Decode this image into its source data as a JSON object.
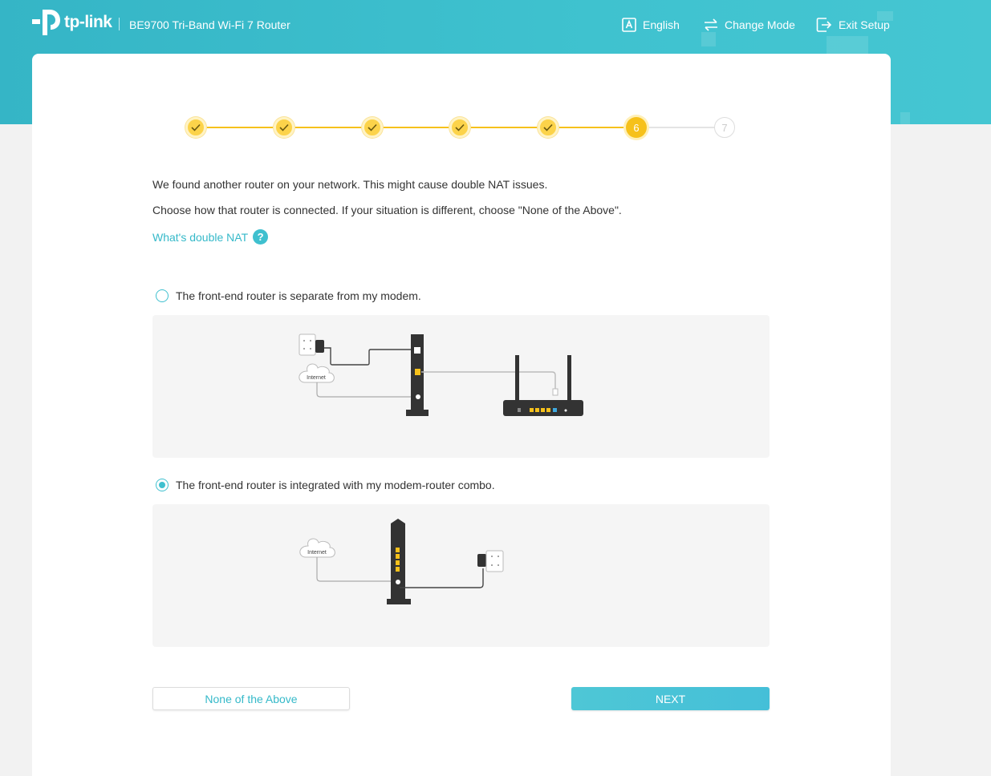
{
  "header": {
    "logo_text": "tp-link",
    "product_name": "BE9700 Tri-Band Wi-Fi 7 Router",
    "language_icon": "language-a-icon",
    "language_label": "English",
    "change_mode_icon": "switch-arrows-icon",
    "change_mode_label": "Change Mode",
    "exit_icon": "exit-arrow-icon",
    "exit_label": "Exit Setup"
  },
  "stepper": {
    "steps": [
      {
        "state": "done"
      },
      {
        "state": "done"
      },
      {
        "state": "done"
      },
      {
        "state": "done"
      },
      {
        "state": "done"
      },
      {
        "state": "active",
        "label": "6"
      },
      {
        "state": "todo",
        "label": "7"
      }
    ],
    "accent_color": "#f6c11b"
  },
  "content": {
    "line1": "We found another router on your network. This might cause double NAT issues.",
    "line2": "Choose how that router is connected. If your situation is different, choose \"None of the Above\".",
    "help_link": "What's double NAT",
    "help_icon": "question-mark-icon"
  },
  "options": [
    {
      "label": "The front-end router is separate from my modem.",
      "selected": false,
      "diagram_cloud_label": "Internet"
    },
    {
      "label": "The front-end router is integrated with my modem-router combo.",
      "selected": true,
      "diagram_cloud_label": "Internet"
    }
  ],
  "buttons": {
    "none_label": "None of the Above",
    "next_label": "NEXT"
  },
  "colors": {
    "brand": "#3fc0cf",
    "link": "#35b9c9"
  }
}
